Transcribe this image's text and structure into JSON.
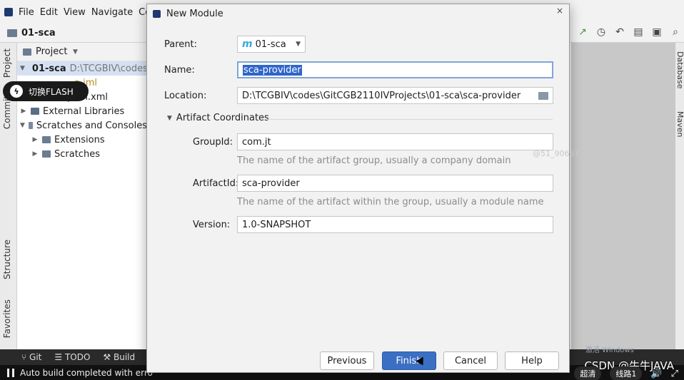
{
  "menubar": {
    "items": [
      "File",
      "Edit",
      "View",
      "Navigate",
      "Code"
    ]
  },
  "toolbar": {
    "project_crumb": "01-sca"
  },
  "left_stripe": {
    "project_tab": "Project",
    "commit_tab": "Commit",
    "structure_tab": "Structure",
    "favorites_tab": "Favorites"
  },
  "project_panel": {
    "header": "Project",
    "tree": [
      {
        "label": "01-sca",
        "path": "D:\\TCGBIV\\codes",
        "selected": true,
        "bold": true
      },
      {
        "label": "a.iml"
      },
      {
        "label": "pom.xml"
      },
      {
        "label": "External Libraries"
      },
      {
        "label": "Scratches and Consoles"
      },
      {
        "label": "Extensions"
      },
      {
        "label": "Scratches"
      }
    ]
  },
  "flash": {
    "label": "切换FLASH"
  },
  "right_stripe": {
    "database_tab": "Database",
    "maven_tab": "Maven"
  },
  "bottom_toolbar": {
    "git": "Git",
    "todo": "TODO",
    "build": "Build"
  },
  "status_bar": {
    "text": "Auto build completed with erro"
  },
  "video": {
    "quality": "超清",
    "line": "线路1",
    "csdn": "CSDN @牛牛JAVA"
  },
  "watermark": {
    "win": "激活 Windows"
  },
  "dialog": {
    "title": "New Module",
    "parent_label": "Parent:",
    "parent_value": "01-sca",
    "name_label": "Name:",
    "name_value": "sca-provider",
    "location_label": "Location:",
    "location_value": "D:\\TCGBIV\\codes\\GitCGB2110IVProjects\\01-sca\\sca-provider",
    "section_title": "Artifact Coordinates",
    "groupid_label": "GroupId:",
    "groupid_value": "com.jt",
    "groupid_hint": "The name of the artifact group, usually a company domain",
    "artifactid_label": "ArtifactId:",
    "artifactid_value": "sca-provider",
    "artifactid_hint": "The name of the artifact within the group, usually a module name",
    "version_label": "Version:",
    "version_value": "1.0-SNAPSHOT",
    "buttons": {
      "previous": "Previous",
      "finish": "Finish",
      "cancel": "Cancel",
      "help": "Help"
    },
    "csdn_mark": "@51_90661"
  }
}
